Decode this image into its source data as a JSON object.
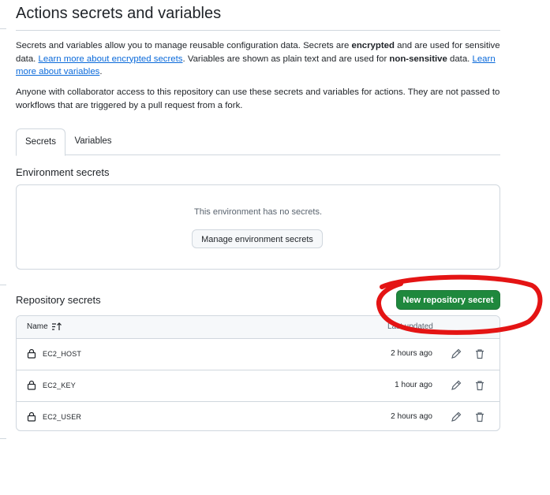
{
  "page": {
    "title": "Actions secrets and variables",
    "intro": {
      "p1_a": "Secrets and variables allow you to manage reusable configuration data. Secrets are ",
      "p1_b": "encrypted",
      "p1_c": " and are used for sensitive data. ",
      "p1_link1": "Learn more about encrypted secrets",
      "p1_d": ". Variables are shown as plain text and are used for ",
      "p1_e": "non-sensitive",
      "p1_f": " data. ",
      "p1_link2": "Learn more about variables",
      "p1_g": ".",
      "p2": "Anyone with collaborator access to this repository can use these secrets and variables for actions. They are not passed to workflows that are triggered by a pull request from a fork."
    }
  },
  "tabs": [
    {
      "label": "Secrets",
      "active": true
    },
    {
      "label": "Variables",
      "active": false
    }
  ],
  "environment": {
    "heading": "Environment secrets",
    "empty_message": "This environment has no secrets.",
    "manage_button": "Manage environment secrets"
  },
  "repository": {
    "heading": "Repository secrets",
    "new_button": "New repository secret",
    "columns": {
      "name": "Name",
      "updated": "Last updated"
    },
    "rows": [
      {
        "name": "EC2_HOST",
        "updated": "2 hours ago"
      },
      {
        "name": "EC2_KEY",
        "updated": "1 hour ago"
      },
      {
        "name": "EC2_USER",
        "updated": "2 hours ago"
      }
    ]
  },
  "colors": {
    "primary_button": "#1f883d",
    "link": "#0969da",
    "annotation": "#e41414"
  },
  "icons": [
    "lock-icon",
    "pencil-icon",
    "trash-icon",
    "sort-ascending-icon"
  ]
}
